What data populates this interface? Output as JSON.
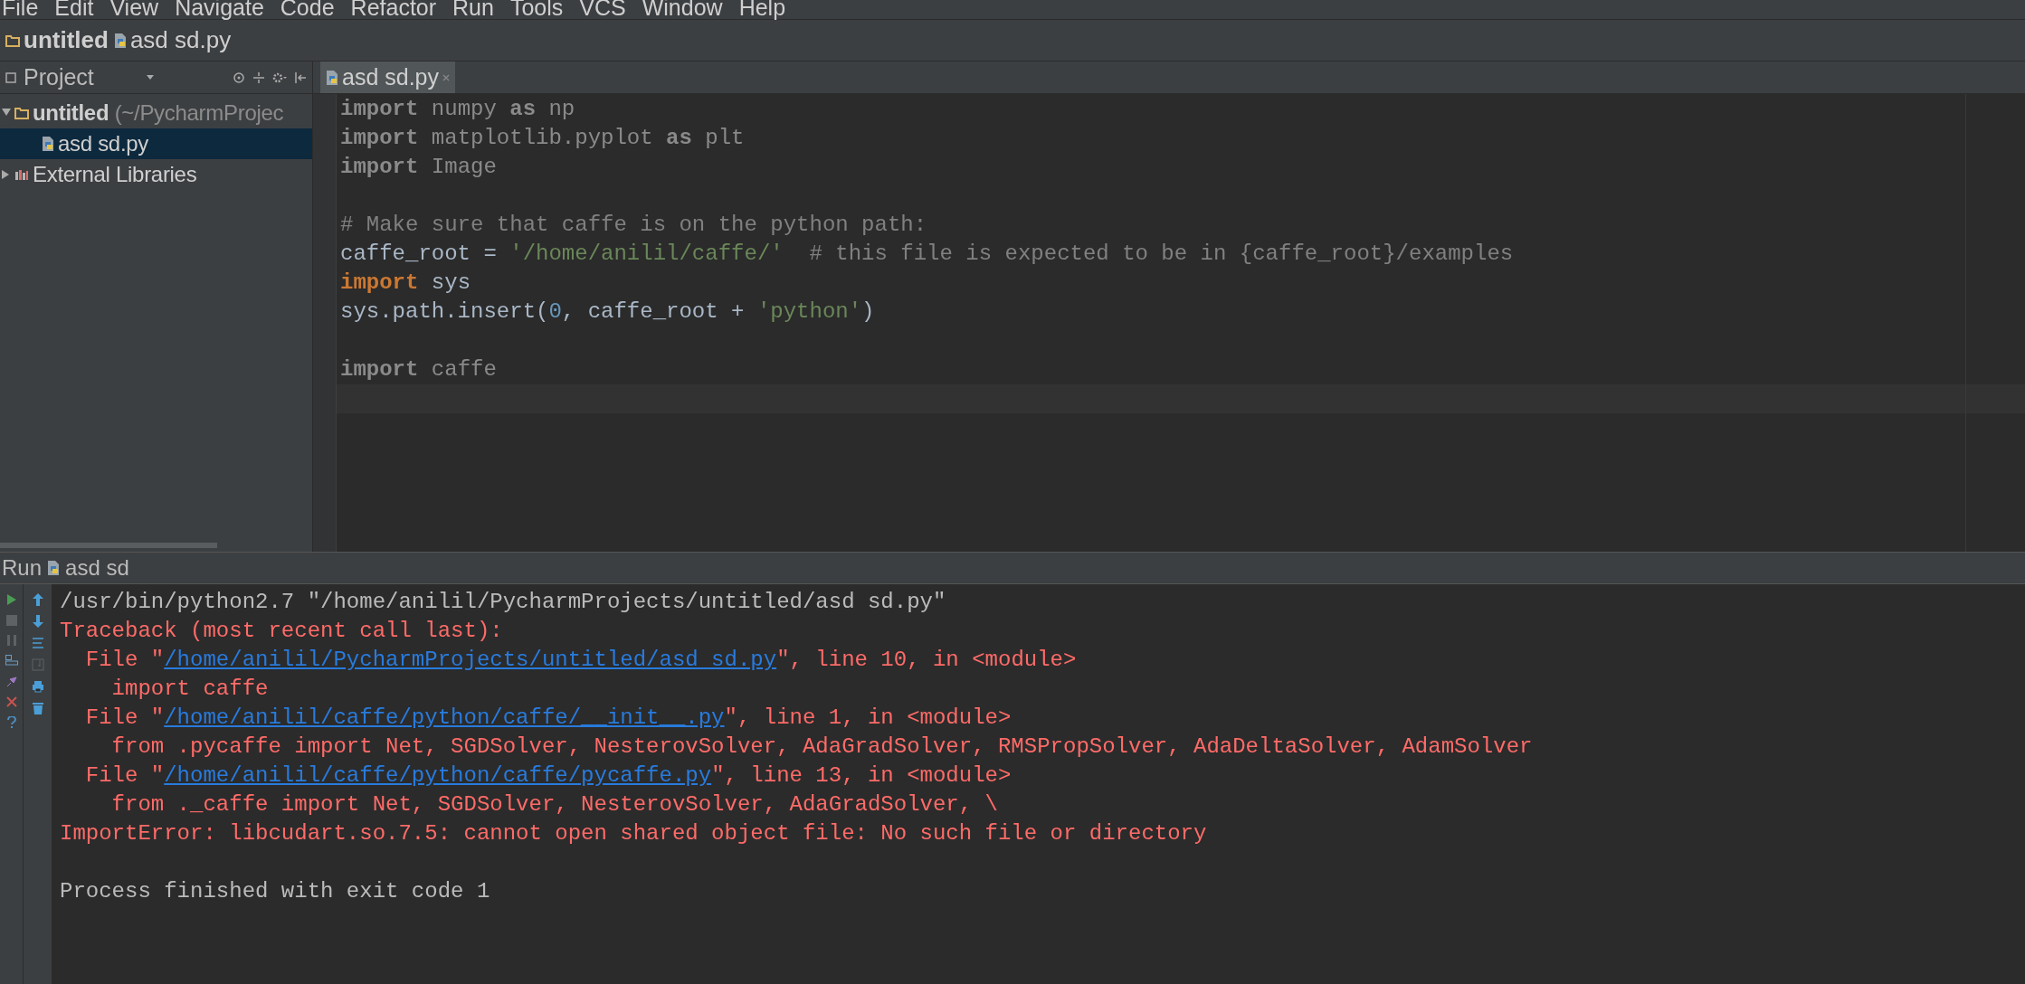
{
  "menu": [
    "File",
    "Edit",
    "View",
    "Navigate",
    "Code",
    "Refactor",
    "Run",
    "Tools",
    "VCS",
    "Window",
    "Help"
  ],
  "breadcrumb": [
    {
      "label": "untitled",
      "kind": "folder"
    },
    {
      "label": "asd sd.py",
      "kind": "file"
    }
  ],
  "project_panel": {
    "title": "Project",
    "tree": [
      {
        "label": "untitled",
        "hint": "(~/PycharmProjec",
        "kind": "folder",
        "expanded": true,
        "selected": false,
        "children": [
          {
            "label": "asd sd.py",
            "kind": "file",
            "selected": true
          }
        ]
      },
      {
        "label": "External Libraries",
        "kind": "library",
        "expanded": false,
        "selected": false
      }
    ]
  },
  "editor": {
    "tabs": [
      {
        "label": "asd sd.py",
        "selected": true
      }
    ],
    "lines": [
      [
        {
          "text": "import",
          "kind": "unused_kw"
        },
        {
          "text": " numpy ",
          "kind": "unused"
        },
        {
          "text": "as",
          "kind": "unused_kw"
        },
        {
          "text": " np",
          "kind": "unused"
        }
      ],
      [
        {
          "text": "import",
          "kind": "unused_kw"
        },
        {
          "text": " matplotlib.pyplot ",
          "kind": "unused"
        },
        {
          "text": "as",
          "kind": "unused_kw"
        },
        {
          "text": " plt",
          "kind": "unused"
        }
      ],
      [
        {
          "text": "import",
          "kind": "unused_kw"
        },
        {
          "text": " Image",
          "kind": "unused"
        }
      ],
      [
        {
          "kind": "blank"
        }
      ],
      [
        {
          "text": "# Make sure that caffe is on the python path:",
          "kind": "comment"
        }
      ],
      [
        {
          "text": "caffe_root = ",
          "kind": "plain"
        },
        {
          "text": "'/home/anilil/caffe/'",
          "kind": "string"
        },
        {
          "text": "  # this file is expected to be in {caffe_root}/examples",
          "kind": "comment"
        }
      ],
      [
        {
          "text": "import",
          "kind": "kw"
        },
        {
          "text": " sys",
          "kind": "plain"
        }
      ],
      [
        {
          "text": "sys.path.insert(",
          "kind": "plain"
        },
        {
          "text": "0",
          "kind": "number"
        },
        {
          "text": ", caffe_root + ",
          "kind": "plain"
        },
        {
          "text": "'python'",
          "kind": "string"
        },
        {
          "text": ")",
          "kind": "plain"
        }
      ],
      [
        {
          "kind": "blank"
        }
      ],
      [
        {
          "text": "import",
          "kind": "unused_kw"
        },
        {
          "text": " caffe",
          "kind": "unused"
        }
      ],
      [
        {
          "kind": "caret_line"
        }
      ]
    ]
  },
  "run_panel": {
    "title": "Run",
    "config": "asd sd",
    "lines": [
      [
        {
          "text": "/usr/bin/python2.7 \"/home/anilil/PycharmProjects/untitled/asd sd.py\"",
          "kind": "plain"
        }
      ],
      [
        {
          "text": "Traceback (most recent call last):",
          "kind": "error"
        }
      ],
      [
        {
          "text": "  File \"",
          "kind": "error"
        },
        {
          "text": "/home/anilil/PycharmProjects/untitled/asd sd.py",
          "kind": "link"
        },
        {
          "text": "\", line 10, in <module>",
          "kind": "error"
        }
      ],
      [
        {
          "text": "    import caffe",
          "kind": "error"
        }
      ],
      [
        {
          "text": "  File \"",
          "kind": "error"
        },
        {
          "text": "/home/anilil/caffe/python/caffe/__init__.py",
          "kind": "link"
        },
        {
          "text": "\", line 1, in <module>",
          "kind": "error"
        }
      ],
      [
        {
          "text": "    from .pycaffe import Net, SGDSolver, NesterovSolver, AdaGradSolver, RMSPropSolver, AdaDeltaSolver, AdamSolver",
          "kind": "error"
        }
      ],
      [
        {
          "text": "  File \"",
          "kind": "error"
        },
        {
          "text": "/home/anilil/caffe/python/caffe/pycaffe.py",
          "kind": "link"
        },
        {
          "text": "\", line 13, in <module>",
          "kind": "error"
        }
      ],
      [
        {
          "text": "    from ._caffe import Net, SGDSolver, NesterovSolver, AdaGradSolver, \\",
          "kind": "error"
        }
      ],
      [
        {
          "text": "ImportError: libcudart.so.7.5: cannot open shared object file: No such file or directory",
          "kind": "error"
        }
      ],
      [
        {
          "kind": "blank"
        }
      ],
      [
        {
          "text": "Process finished with exit code 1",
          "kind": "plain"
        }
      ]
    ]
  }
}
